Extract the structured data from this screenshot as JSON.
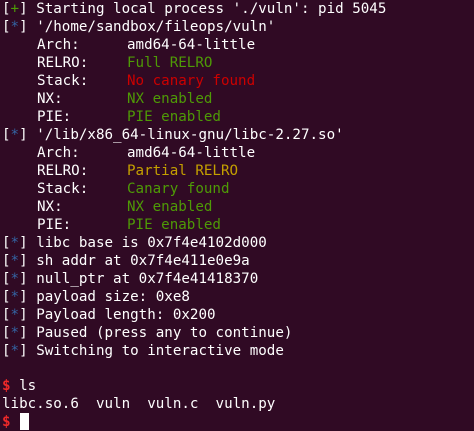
{
  "terminal": {
    "start_line": {
      "prefix": "+",
      "text": "Starting local process './vuln': pid 5045"
    },
    "binary": {
      "path_line": "'/home/sandbox/fileops/vuln'",
      "rows": [
        {
          "label": "Arch:",
          "value": "amd64-64-little",
          "color": "#ffffff"
        },
        {
          "label": "RELRO:",
          "value": "Full RELRO",
          "color": "#4e9a06"
        },
        {
          "label": "Stack:",
          "value": "No canary found",
          "color": "#cc0000"
        },
        {
          "label": "NX:",
          "value": "NX enabled",
          "color": "#4e9a06"
        },
        {
          "label": "PIE:",
          "value": "PIE enabled",
          "color": "#4e9a06"
        }
      ]
    },
    "libc": {
      "path_line": "'/lib/x86_64-linux-gnu/libc-2.27.so'",
      "rows": [
        {
          "label": "Arch:",
          "value": "amd64-64-little",
          "color": "#ffffff"
        },
        {
          "label": "RELRO:",
          "value": "Partial RELRO",
          "color": "#c4a000"
        },
        {
          "label": "Stack:",
          "value": "Canary found",
          "color": "#4e9a06"
        },
        {
          "label": "NX:",
          "value": "NX enabled",
          "color": "#4e9a06"
        },
        {
          "label": "PIE:",
          "value": "PIE enabled",
          "color": "#4e9a06"
        }
      ]
    },
    "info_lines": [
      "libc base is 0x7f4e4102d000",
      "sh addr at 0x7f4e411e0e9a",
      "null_ptr at 0x7f4e41418370",
      "payload size: 0xe8",
      "Payload length: 0x200",
      "Paused (press any to continue)",
      "Switching to interactive mode"
    ],
    "info_prefix": "*",
    "prompt_symbol": "$",
    "command": "ls",
    "ls_output": "libc.so.6  vuln  vuln.c  vuln.py",
    "colors": {
      "background": "#300a24",
      "foreground": "#ffffff",
      "plus": "#4e9a06",
      "star": "#3465a4",
      "prompt": "#ef2929"
    }
  }
}
